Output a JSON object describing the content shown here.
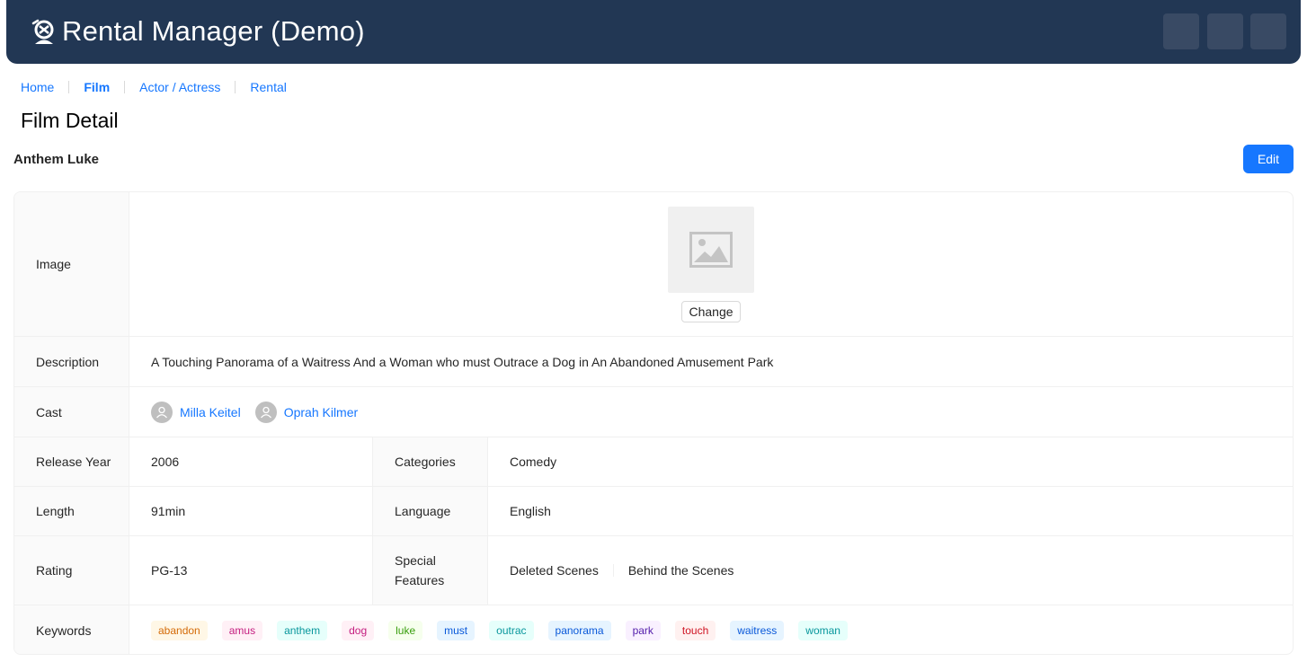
{
  "header": {
    "title": "Rental Manager (Demo)",
    "logo_icon": "detective-icon",
    "background": "#223754",
    "buttons": [
      "header-button-1",
      "header-button-2",
      "header-button-3"
    ]
  },
  "breadcrumb": [
    {
      "label": "Home",
      "active": false
    },
    {
      "label": "Film",
      "active": true
    },
    {
      "label": "Actor / Actress",
      "active": false
    },
    {
      "label": "Rental",
      "active": false
    }
  ],
  "page_title": "Film Detail",
  "film": {
    "name": "Anthem Luke",
    "edit_label": "Edit"
  },
  "details": {
    "image_label": "Image",
    "change_label": "Change",
    "description_label": "Description",
    "description": "A Touching Panorama of a Waitress And a Woman who must Outrace a Dog in An Abandoned Amusement Park",
    "cast_label": "Cast",
    "cast": [
      "Milla Keitel",
      "Oprah Kilmer"
    ],
    "release_year_label": "Release Year",
    "release_year": "2006",
    "categories_label": "Categories",
    "categories": "Comedy",
    "length_label": "Length",
    "length": "91min",
    "language_label": "Language",
    "language": "English",
    "rating_label": "Rating",
    "rating": "PG-13",
    "special_features_label": "Special Features",
    "special_features": [
      "Deleted Scenes",
      "Behind the Scenes"
    ],
    "keywords_label": "Keywords",
    "keywords": [
      {
        "label": "abandon",
        "bg": "#fff7e6",
        "color": "#d46b08"
      },
      {
        "label": "amus",
        "bg": "#fff0f6",
        "color": "#c41d7f"
      },
      {
        "label": "anthem",
        "bg": "#e6fffb",
        "color": "#08979c"
      },
      {
        "label": "dog",
        "bg": "#fff0f6",
        "color": "#c41d7f"
      },
      {
        "label": "luke",
        "bg": "#f6ffed",
        "color": "#389e0d"
      },
      {
        "label": "must",
        "bg": "#e6f4ff",
        "color": "#0958d9"
      },
      {
        "label": "outrac",
        "bg": "#e6fffb",
        "color": "#08979c"
      },
      {
        "label": "panorama",
        "bg": "#e6f4ff",
        "color": "#0958d9"
      },
      {
        "label": "park",
        "bg": "#f9f0ff",
        "color": "#531dab"
      },
      {
        "label": "touch",
        "bg": "#fff1f0",
        "color": "#cf1322"
      },
      {
        "label": "waitress",
        "bg": "#e6f4ff",
        "color": "#0958d9"
      },
      {
        "label": "woman",
        "bg": "#e6fffb",
        "color": "#08979c"
      }
    ]
  },
  "colors": {
    "primary": "#1677ff",
    "label_bg": "#fafafa",
    "border": "#f0f0f0"
  }
}
